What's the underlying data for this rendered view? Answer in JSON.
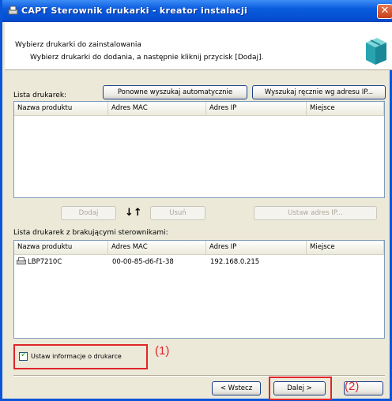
{
  "window": {
    "title": "CAPT Sterownik drukarki - kreator instalacji"
  },
  "header": {
    "title": "Wybierz drukarki do zainstalowania",
    "subtitle": "Wybierz drukarki do dodania, a następnie kliknij przycisk [Dodaj]."
  },
  "printers": {
    "label": "Lista drukarek:",
    "rescan_button": "Ponowne wyszukaj automatycznie",
    "manual_search_button": "Wyszukaj ręcznie wg adresu IP...",
    "columns": [
      "Nazwa produktu",
      "Adres MAC",
      "Adres IP",
      "Miejsce"
    ]
  },
  "actions": {
    "add_button": "Dodaj",
    "arrows": "↓↑",
    "remove_button": "Usuń",
    "set_ip_button": "Ustaw adres IP..."
  },
  "missing_drivers": {
    "label": "Lista drukarek z brakującymi sterownikami:",
    "columns": [
      "Nazwa produktu",
      "Adres MAC",
      "Adres IP",
      "Miejsce"
    ],
    "rows": [
      {
        "name": "LBP7210C",
        "mac": "00-00-85-d6-f1-38",
        "ip": "192.168.0.215",
        "place": ""
      }
    ]
  },
  "options": {
    "set_info_checkbox": "Ustaw informacje o drukarce",
    "checked": true
  },
  "navigation": {
    "back_button": "< Wstecz",
    "next_button": "Dalej >",
    "cancel_button": ""
  },
  "callouts": {
    "first": "(1)",
    "second": "(2)"
  },
  "colors": {
    "titlebar": "#0a5bde",
    "highlight": "#e0252b",
    "dialog": "#ece9d8"
  }
}
